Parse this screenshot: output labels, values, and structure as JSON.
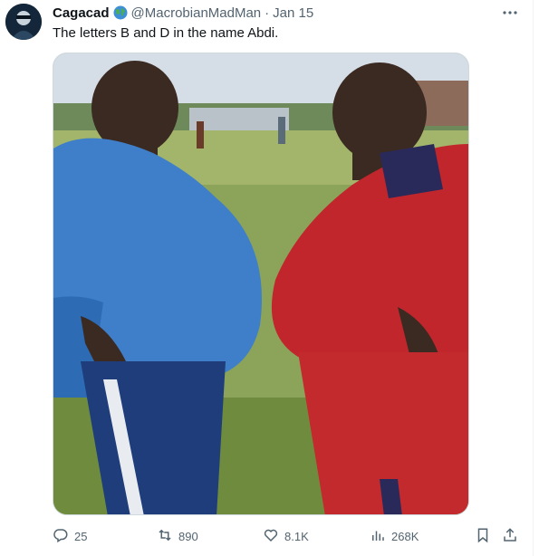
{
  "tweet": {
    "display_name": "Cagacad",
    "handle": "@MacrobianMadMan",
    "separator": "·",
    "date": "Jan 15",
    "text": "The letters B and D in the name Abdi."
  },
  "actions": {
    "replies": "25",
    "reposts": "890",
    "likes": "8.1K",
    "views": "268K"
  },
  "icons": {
    "verified": "globe-icon",
    "more": "more-icon",
    "reply": "reply-icon",
    "repost": "repost-icon",
    "like": "heart-icon",
    "views": "views-chart-icon",
    "bookmark": "bookmark-icon",
    "share": "share-icon"
  },
  "colors": {
    "text_primary": "#0f1419",
    "text_secondary": "#536471",
    "border": "#cfd9de"
  }
}
